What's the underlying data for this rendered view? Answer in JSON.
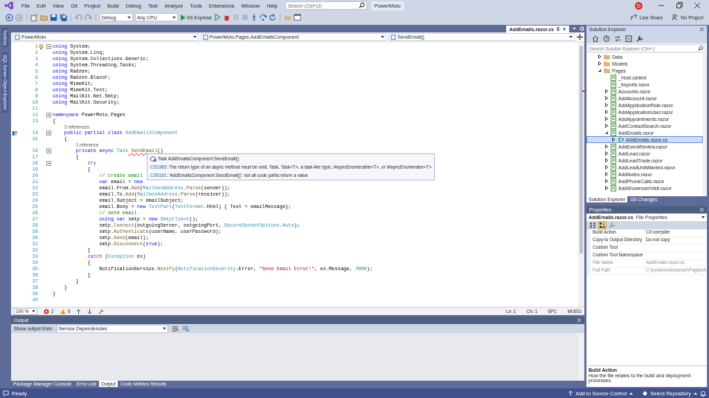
{
  "menu": {
    "items": [
      "File",
      "Edit",
      "View",
      "Git",
      "Project",
      "Build",
      "Debug",
      "Test",
      "Analyze",
      "Tools",
      "Extensions",
      "Window",
      "Help"
    ],
    "search": {
      "placeholder": "Search (Ctrl+Q)"
    },
    "solution": "PowerMoto",
    "account_initial": "D"
  },
  "toolbar": {
    "configuration": "Debug",
    "platform": "Any CPU",
    "run_target": "IIS Express",
    "live_share": "Live Share",
    "project": "No Project"
  },
  "side_tabs": [
    "Toolbox",
    "SQL Server Object Explorer"
  ],
  "editor": {
    "tabs": [
      {
        "label": "AddEmails.razor.cs",
        "selected": true
      }
    ],
    "nav": [
      "PowerMoto",
      "PowerMoto.Pages.AddEmailsComponent",
      "SendEmail()"
    ],
    "lines": [
      {
        "n": "1",
        "fold": true,
        "code": [
          {
            "kind": "k",
            "text": "using"
          },
          {
            "kind": "p",
            "text": " System;"
          }
        ]
      },
      {
        "n": "2",
        "fold": false,
        "code": [
          {
            "kind": "k",
            "text": "using"
          },
          {
            "kind": "p",
            "text": " System.Linq;"
          }
        ]
      },
      {
        "n": "3",
        "fold": false,
        "code": [
          {
            "kind": "k",
            "text": "using"
          },
          {
            "kind": "p",
            "text": " System.Collections.Generic;"
          }
        ]
      },
      {
        "n": "4",
        "fold": false,
        "code": [
          {
            "kind": "k",
            "text": "using"
          },
          {
            "kind": "p",
            "text": " System.Threading.Tasks;"
          }
        ]
      },
      {
        "n": "5",
        "fold": false,
        "code": [
          {
            "kind": "k",
            "text": "using"
          },
          {
            "kind": "p",
            "text": " Radzen;"
          }
        ]
      },
      {
        "n": "6",
        "fold": false,
        "code": [
          {
            "kind": "k",
            "text": "using"
          },
          {
            "kind": "p",
            "text": " Radzen.Blazor;"
          }
        ]
      },
      {
        "n": "7",
        "fold": false,
        "code": [
          {
            "kind": "k",
            "text": "using"
          },
          {
            "kind": "p",
            "text": " MimeKit;"
          }
        ]
      },
      {
        "n": "8",
        "fold": false,
        "code": [
          {
            "kind": "k",
            "text": "using"
          },
          {
            "kind": "p",
            "text": " MimeKit.Text;"
          }
        ]
      },
      {
        "n": "9",
        "fold": false,
        "code": [
          {
            "kind": "k",
            "text": "using"
          },
          {
            "kind": "p",
            "text": " MailKit.Net.Smtp;"
          }
        ]
      },
      {
        "n": "10",
        "fold": false,
        "code": [
          {
            "kind": "k",
            "text": "using"
          },
          {
            "kind": "p",
            "text": " MailKit.Security;"
          }
        ]
      },
      {
        "n": "11",
        "fold": false
      },
      {
        "n": "12",
        "fold": true,
        "code": [
          {
            "kind": "k",
            "text": "namespace"
          },
          {
            "kind": "p",
            "text": " PowerMoto.Pages"
          }
        ]
      },
      {
        "n": "13",
        "fold": false,
        "code": [
          {
            "kind": "p",
            "text": "{"
          }
        ]
      },
      {
        "n": "14",
        "fold": true,
        "lens": "3 references",
        "code": [
          {
            "kind": "k",
            "text": "    public partial class"
          },
          {
            "kind": "t",
            "text": " AddEmailsComponent"
          }
        ]
      },
      {
        "n": "15",
        "fold": false,
        "code": [
          {
            "kind": "p",
            "text": "    {"
          }
        ]
      },
      {
        "n": "16",
        "fold": true,
        "lens": "1 reference",
        "code": [
          {
            "kind": "k",
            "text": "        private async"
          },
          {
            "kind": "t",
            "text": " Task"
          },
          {
            "kind": "e",
            "text": " SendEmail"
          },
          {
            "kind": "p",
            "text": "()"
          }
        ]
      },
      {
        "n": "17",
        "fold": false,
        "code": [
          {
            "kind": "p",
            "text": "        {"
          }
        ]
      },
      {
        "n": "18",
        "fold": true,
        "code": [
          {
            "kind": "c",
            "text": "            try"
          }
        ]
      },
      {
        "n": "19",
        "fold": false,
        "code": [
          {
            "kind": "p",
            "text": "            {"
          }
        ]
      },
      {
        "n": "20",
        "fold": false,
        "code": [
          {
            "kind": "cm",
            "text": "                // create email"
          }
        ]
      },
      {
        "n": "21",
        "fold": false,
        "code": [
          {
            "kind": "k",
            "text": "                var"
          },
          {
            "kind": "p",
            "text": " email = "
          },
          {
            "kind": "k",
            "text": "new"
          }
        ]
      },
      {
        "n": "22",
        "fold": false,
        "code": [
          {
            "kind": "p",
            "text": "                email.From."
          },
          {
            "kind": "m",
            "text": "Add"
          },
          {
            "kind": "p",
            "text": "("
          },
          {
            "kind": "t",
            "text": "MailboxAddress"
          },
          {
            "kind": "p",
            "text": "."
          },
          {
            "kind": "m",
            "text": "Parse"
          },
          {
            "kind": "p",
            "text": "(sender));"
          }
        ]
      },
      {
        "n": "23",
        "fold": false,
        "code": [
          {
            "kind": "p",
            "text": "                email.To."
          },
          {
            "kind": "m",
            "text": "Add"
          },
          {
            "kind": "p",
            "text": "("
          },
          {
            "kind": "t",
            "text": "MailboxAddress"
          },
          {
            "kind": "p",
            "text": "."
          },
          {
            "kind": "m",
            "text": "Parse"
          },
          {
            "kind": "p",
            "text": "(receiver));"
          }
        ]
      },
      {
        "n": "24",
        "fold": false,
        "code": [
          {
            "kind": "p",
            "text": "                email.Subject = emailSubject;"
          }
        ]
      },
      {
        "n": "25",
        "fold": false,
        "code": [
          {
            "kind": "p",
            "text": "                email.Body = "
          },
          {
            "kind": "k",
            "text": "new"
          },
          {
            "kind": "t",
            "text": " TextPart"
          },
          {
            "kind": "p",
            "text": "("
          },
          {
            "kind": "t",
            "text": "TextFormat"
          },
          {
            "kind": "p",
            "text": ".Html) { Text = emailMessage};"
          }
        ]
      },
      {
        "n": "26",
        "fold": false,
        "code": [
          {
            "kind": "cm",
            "text": "                // send email"
          }
        ]
      },
      {
        "n": "27",
        "fold": false,
        "code": [
          {
            "kind": "k",
            "text": "                using var"
          },
          {
            "kind": "p",
            "text": " smtp = "
          },
          {
            "kind": "k",
            "text": "new"
          },
          {
            "kind": "t",
            "text": " SmtpClient"
          },
          {
            "kind": "p",
            "text": "();"
          }
        ]
      },
      {
        "n": "28",
        "fold": false,
        "code": [
          {
            "kind": "p",
            "text": "                smtp."
          },
          {
            "kind": "m",
            "text": "Connect"
          },
          {
            "kind": "p",
            "text": "(outgoingServer, outgoingPort, "
          },
          {
            "kind": "t",
            "text": "SecureSocketOptions"
          },
          {
            "kind": "p",
            "text": "."
          },
          {
            "kind": "t",
            "text": "Auto"
          },
          {
            "kind": "p",
            "text": ");"
          }
        ]
      },
      {
        "n": "29",
        "fold": false,
        "code": [
          {
            "kind": "p",
            "text": "                smtp."
          },
          {
            "kind": "m",
            "text": "Authenticate"
          },
          {
            "kind": "p",
            "text": "(userName, userPassword);"
          }
        ]
      },
      {
        "n": "30",
        "fold": false,
        "code": [
          {
            "kind": "p",
            "text": "                smtp."
          },
          {
            "kind": "m",
            "text": "Send"
          },
          {
            "kind": "p",
            "text": "(email);"
          }
        ]
      },
      {
        "n": "31",
        "fold": false,
        "code": [
          {
            "kind": "p",
            "text": "                smtp."
          },
          {
            "kind": "m",
            "text": "Disconnect"
          },
          {
            "kind": "p",
            "text": "("
          },
          {
            "kind": "k",
            "text": "true"
          },
          {
            "kind": "p",
            "text": ");"
          }
        ]
      },
      {
        "n": "32",
        "fold": false,
        "code": [
          {
            "kind": "p",
            "text": "            }"
          }
        ]
      },
      {
        "n": "33",
        "fold": false,
        "code": [
          {
            "kind": "c",
            "text": "            catch"
          },
          {
            "kind": "p",
            "text": " ("
          },
          {
            "kind": "t",
            "text": "Exception"
          },
          {
            "kind": "p",
            "text": " ex)"
          }
        ]
      },
      {
        "n": "34",
        "fold": false,
        "code": [
          {
            "kind": "p",
            "text": "            {"
          }
        ]
      },
      {
        "n": "35",
        "fold": false,
        "code": [
          {
            "kind": "p",
            "text": "                NotificationService."
          },
          {
            "kind": "m",
            "text": "Notify"
          },
          {
            "kind": "p",
            "text": "("
          },
          {
            "kind": "t",
            "text": "NotificationSeverity"
          },
          {
            "kind": "p",
            "text": ".Error, "
          },
          {
            "kind": "s",
            "text": "\"Send Email Error!\""
          },
          {
            "kind": "p",
            "text": ", ex.Message, "
          },
          {
            "kind": "n",
            "text": "7000"
          },
          {
            "kind": "p",
            "text": ");"
          }
        ]
      },
      {
        "n": "36",
        "fold": false,
        "code": [
          {
            "kind": "p",
            "text": "            }"
          }
        ]
      },
      {
        "n": "37",
        "fold": false,
        "code": [
          {
            "kind": "p",
            "text": "        }"
          }
        ]
      },
      {
        "n": "38",
        "fold": false,
        "code": [
          {
            "kind": "p",
            "text": "    }"
          }
        ]
      },
      {
        "n": "39",
        "fold": false,
        "code": [
          {
            "kind": "p",
            "text": "}"
          }
        ]
      },
      {
        "n": "40",
        "fold": false
      }
    ],
    "quick_info": {
      "signature": "Task AddEmailsComponent.SendEmail()",
      "errors": [
        {
          "code": "CS1983",
          "message": ": The return type of an async method must be void, Task, Task<T>, a task-like type, IAsyncEnumerable<T>, or IAsyncEnumerator<T>"
        },
        {
          "code": "CS0161",
          "message": ": 'AddEmailsComponent.SendEmail()': not all code paths return a value"
        }
      ]
    },
    "status": {
      "zoom": "100 %",
      "errors": "2",
      "warnings": "0",
      "line": "Ln: 1",
      "column": "Ch: 1",
      "whitespace": "SPC",
      "line_endings": "MIXED"
    }
  },
  "output": {
    "title": "Output",
    "source_label": "Show output from:",
    "source": "Service Dependencies",
    "tabs": [
      {
        "label": "Package Manager Console",
        "selected": false
      },
      {
        "label": "Error List",
        "selected": false
      },
      {
        "label": "Output",
        "selected": true
      },
      {
        "label": "Code Metrics Results",
        "selected": false
      }
    ]
  },
  "solution_explorer": {
    "title": "Solution Explorer",
    "search": {
      "placeholder": "Search Solution Explorer (Ctrl+;)"
    },
    "tree": [
      {
        "label": "Data",
        "kind": "folder",
        "expanded": false,
        "selected": false
      },
      {
        "label": "Models",
        "kind": "folder",
        "expanded": false,
        "selected": false
      },
      {
        "label": "Pages",
        "kind": "folder",
        "expanded": true,
        "selected": false,
        "children": [
          {
            "label": "_Host.cshtml",
            "kind": "page",
            "selected": false
          },
          {
            "label": "_Imports.razor",
            "kind": "page",
            "selected": false
          },
          {
            "label": "Accounts.razor",
            "kind": "page",
            "expanded": false,
            "selected": false
          },
          {
            "label": "AddAccount.razor",
            "kind": "page",
            "expanded": false,
            "selected": false
          },
          {
            "label": "AddApplicationRole.razor",
            "kind": "page",
            "expanded": false,
            "selected": false
          },
          {
            "label": "AddApplicationUser.razor",
            "kind": "page",
            "expanded": false,
            "selected": false
          },
          {
            "label": "AddAppointments.razor",
            "kind": "page",
            "expanded": false,
            "selected": false
          },
          {
            "label": "AddContactSearch.razor",
            "kind": "page",
            "expanded": false,
            "selected": false
          },
          {
            "label": "AddEmails.razor",
            "kind": "page",
            "expanded": true,
            "selected": false,
            "children": [
              {
                "label": "AddEmails.razor.cs",
                "kind": "csharp",
                "expanded": false,
                "selected": true
              }
            ]
          },
          {
            "label": "AddEventReview.razor",
            "kind": "page",
            "expanded": false,
            "selected": false
          },
          {
            "label": "AddLead.razor",
            "kind": "page",
            "expanded": false,
            "selected": false
          },
          {
            "label": "AddLeadTrade.razor",
            "kind": "page",
            "expanded": false,
            "selected": false
          },
          {
            "label": "AddLeadUnitWanted.razor",
            "kind": "page",
            "expanded": false,
            "selected": false
          },
          {
            "label": "AddNotes.razor",
            "kind": "page",
            "expanded": false,
            "selected": false
          },
          {
            "label": "AddPhoneCalls.razor",
            "kind": "page",
            "expanded": false,
            "selected": false
          },
          {
            "label": "AddShowroomVisit.razor",
            "kind": "page",
            "expanded": false,
            "selected": false
          }
        ]
      }
    ],
    "tabs": [
      {
        "label": "Solution Explorer",
        "selected": true
      },
      {
        "label": "Git Changes",
        "selected": false
      }
    ]
  },
  "properties": {
    "title": "Properties",
    "object": "AddEmails.razor.cs",
    "object_type": "File Properties",
    "rows": [
      {
        "name": "Build Action",
        "value": "C# compiler",
        "disabled": false
      },
      {
        "name": "Copy to Output Directory",
        "value": "Do not copy",
        "disabled": false
      },
      {
        "name": "Custom Tool",
        "disabled": false
      },
      {
        "name": "Custom Tool Namespace",
        "disabled": false
      },
      {
        "name": "File Name",
        "value": "AddEmails.razor.cs",
        "disabled": true
      },
      {
        "name": "Full Path",
        "value": "C:\\powermoto\\server\\Pages\\A",
        "disabled": true
      }
    ],
    "description": {
      "title": "Build Action",
      "text": "How the file relates to the build and deployment processes."
    }
  },
  "status_bar": {
    "state": "Ready",
    "source_control": "Add to Source Control",
    "repository": "Select Repository"
  }
}
